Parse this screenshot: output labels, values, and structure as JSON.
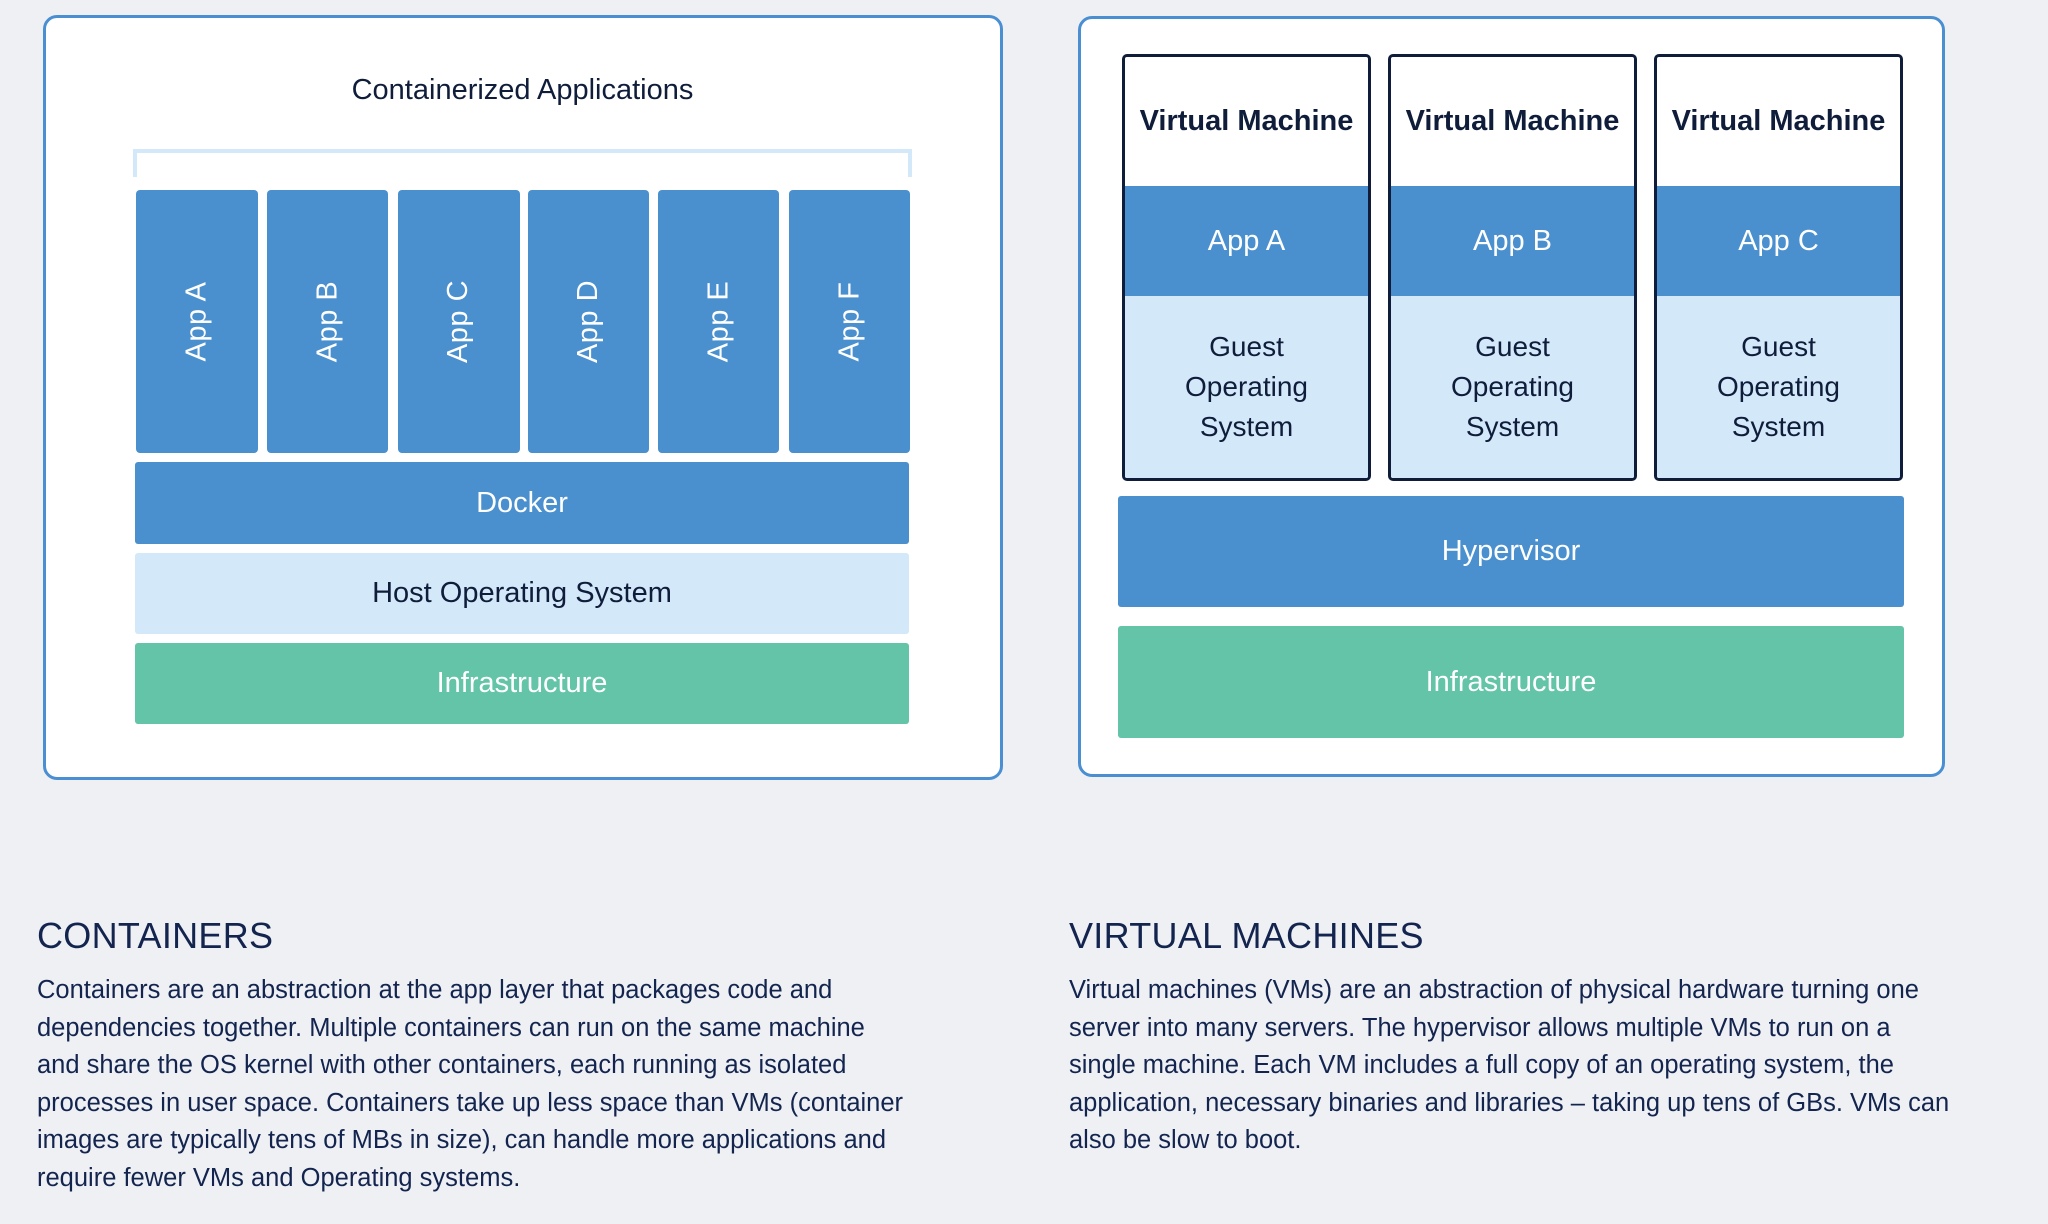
{
  "containers_diagram": {
    "title": "Containerized Applications",
    "apps": [
      "App A",
      "App B",
      "App C",
      "App D",
      "App E",
      "App F"
    ],
    "layers": {
      "runtime": "Docker",
      "host_os": "Host Operating System",
      "infrastructure": "Infrastructure"
    }
  },
  "vm_diagram": {
    "vms": [
      {
        "header": "Virtual Machine",
        "app": "App A",
        "guest_os": [
          "Guest",
          "Operating",
          "System"
        ]
      },
      {
        "header": "Virtual Machine",
        "app": "App B",
        "guest_os": [
          "Guest",
          "Operating",
          "System"
        ]
      },
      {
        "header": "Virtual Machine",
        "app": "App C",
        "guest_os": [
          "Guest",
          "Operating",
          "System"
        ]
      }
    ],
    "layers": {
      "hypervisor": "Hypervisor",
      "infrastructure": "Infrastructure"
    }
  },
  "sections": {
    "containers": {
      "heading": "CONTAINERS",
      "lines": [
        "Containers are an abstraction at the app layer that packages code and",
        "dependencies together. Multiple containers can run on the same machine",
        "and share the OS kernel with other containers, each running as isolated",
        "processes in user space. Containers take up less space than VMs (container",
        "images are typically tens of MBs in size), can handle more applications and",
        "require fewer VMs and Operating systems."
      ]
    },
    "virtual_machines": {
      "heading": "VIRTUAL MACHINES",
      "lines": [
        "Virtual machines (VMs) are an abstraction of physical hardware turning one",
        "server into many servers. The hypervisor allows multiple VMs to run on a",
        "single machine. Each VM includes a full copy of an operating system, the",
        "application, necessary binaries and libraries – taking up tens of GBs. VMs can",
        "also be slow to boot."
      ]
    }
  },
  "colors": {
    "background": "#eef0f3",
    "card_border": "#4a8fd2",
    "app_blue": "#4a90cf",
    "light_blue": "#d3e8f8",
    "infrastructure_green": "#63c4a8",
    "text_navy": "#0f1d3a"
  }
}
